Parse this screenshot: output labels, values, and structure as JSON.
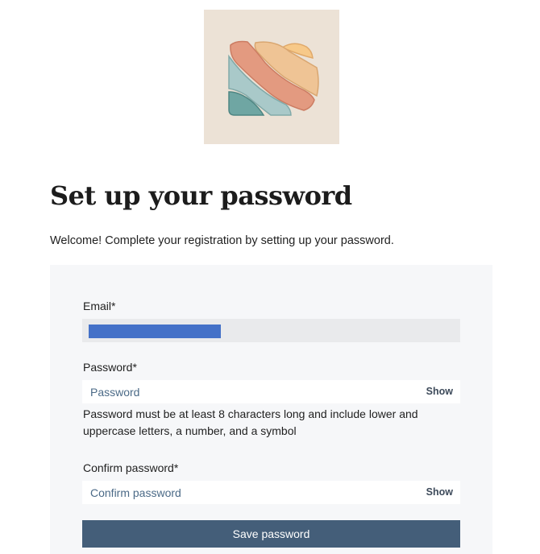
{
  "logo": {
    "icon": "abstract-landscape-logo",
    "background": "#ece2d6",
    "colors": [
      "#e69a80",
      "#f0c08f",
      "#f7c989",
      "#a9c9c9",
      "#6fa6a3"
    ]
  },
  "heading": {
    "title": "Set up your password",
    "subtitle": "Welcome! Complete your registration by setting up your password."
  },
  "form": {
    "email": {
      "label": "Email*",
      "value_redacted": true
    },
    "password": {
      "label": "Password*",
      "placeholder": "Password",
      "toggle_label": "Show",
      "hint": "Password must be at least 8 characters long and include lower and uppercase letters, a number, and a symbol"
    },
    "confirm_password": {
      "label": "Confirm password*",
      "placeholder": "Confirm password",
      "toggle_label": "Show"
    },
    "submit_label": "Save password"
  },
  "colors": {
    "card_background": "#f6f7f9",
    "primary_button": "#445e79",
    "redaction": "#4471c8",
    "placeholder_text": "#4b6a87"
  }
}
